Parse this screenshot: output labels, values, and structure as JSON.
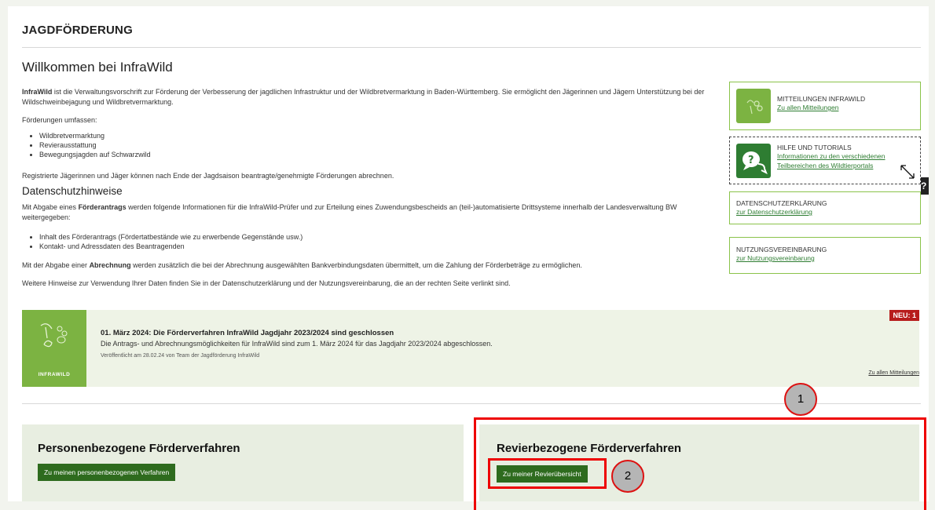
{
  "page_title": "JAGDFÖRDERUNG",
  "welcome_title": "Willkommen bei InfraWild",
  "intro": {
    "brand": "InfraWild",
    "text": " ist die Verwaltungsvorschrift zur Förderung der Verbesserung der jagdlichen Infrastruktur und der Wildbretvermarktung in Baden-Württemberg. Sie ermöglicht den Jägerinnen und Jägern Unterstützung bei der Wildschweinbejagung und Wildbretvermarktung."
  },
  "foerderungen_label": "Förderungen umfassen:",
  "foerderungen": [
    "Wildbretvermarktung",
    "Revierausstattung",
    "Bewegungsjagden auf Schwarzwild"
  ],
  "registered_text": "Registrierte Jägerinnen und Jäger können nach Ende der Jagdsaison beantragte/genehmigte Förderungen abrechnen.",
  "datenschutz_title": "Datenschutzhinweise",
  "ds_p1_a": "Mit Abgabe eines ",
  "ds_p1_bold": "Förderantrags",
  "ds_p1_b": " werden folgende Informationen für die InfraWild-Prüfer und zur Erteilung eines Zuwendungsbescheids an (teil-)automatisierte Drittsysteme innerhalb der Landesverwaltung BW weitergegeben:",
  "ds_items": [
    "Inhalt des Förderantrags (Fördertatbestände wie zu erwerbende Gegenstände usw.)",
    "Kontakt- und Adressdaten des Beantragenden"
  ],
  "ds_p2_a": "Mit der Abgabe einer ",
  "ds_p2_bold": "Abrechnung",
  "ds_p2_b": " werden zusätzlich die bei der Abrechnung ausgewählten Bankverbindungsdaten übermittelt, um die Zahlung der Förderbeträge zu ermöglichen.",
  "ds_p3": "Weitere Hinweise zur Verwendung Ihrer Daten finden Sie in der Datenschutzerklärung und der Nutzungsvereinbarung, die an der rechten Seite verlinkt sind.",
  "sidebar": {
    "mitteilungen": {
      "title": "MITTEILUNGEN INFRAWILD",
      "link": "Zu allen Mitteilungen"
    },
    "hilfe": {
      "title": "HILFE UND TUTORIALS",
      "link1": "Informationen zu den verschiedenen",
      "link2": "Teilbereichen des Wildtierportals"
    },
    "datenschutz": {
      "title": "DATENSCHUTZERKLÄRUNG",
      "link": "zur Datenschutzerklärung"
    },
    "nutzung": {
      "title": "NUTZUNGSVEREINBARUNG",
      "link": "zur Nutzungsvereinbarung"
    }
  },
  "help_tab": "?",
  "news": {
    "logo_text": "INFRAWILD",
    "badge": "NEU: 1",
    "headline": "01. März 2024: Die Förderverfahren InfraWild Jagdjahr 2023/2024 sind geschlossen",
    "body": "Die Antrags- und Abrechnungsmöglichkeiten für InfraWild sind zum 1. März 2024 für das Jagdjahr 2023/2024 abgeschlossen.",
    "meta": "Veröffentlicht am 28.02.24 von Team der Jagdförderung InfraWild",
    "all_link": "Zu allen Mitteilungen"
  },
  "personen": {
    "title": "Personenbezogene Förderverfahren",
    "button": "Zu meinen personenbezogenen Verfahren"
  },
  "revier": {
    "title": "Revierbezogene Förderverfahren",
    "button": "Zu meiner Revierübersicht"
  },
  "markers": [
    "1",
    "2"
  ],
  "colors": {
    "green_dark": "#2e6b1e",
    "green_light": "#7cb342",
    "red": "#e00000",
    "badge": "#b71c1c"
  }
}
